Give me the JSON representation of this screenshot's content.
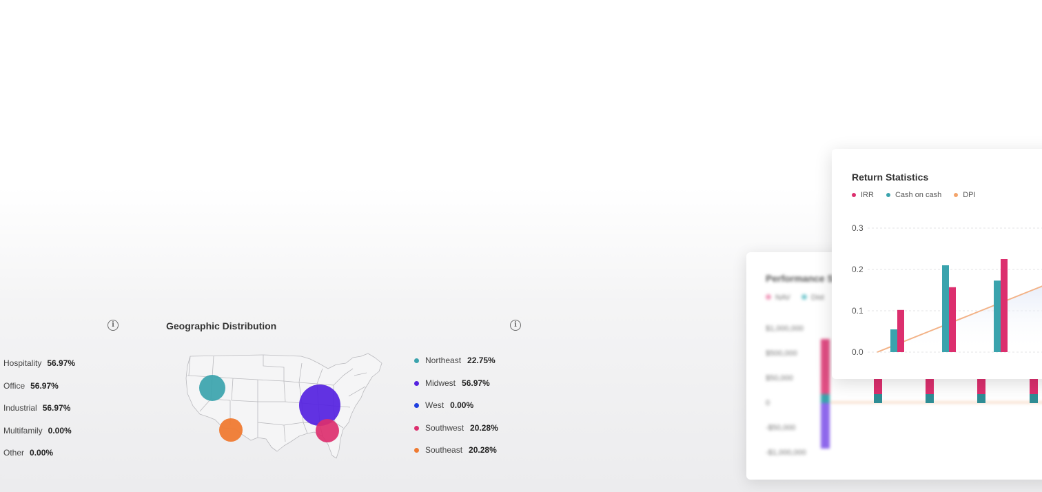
{
  "property_types": {
    "items": [
      {
        "label": "Hospitality",
        "value": "56.97%"
      },
      {
        "label": "Office",
        "value": "56.97%"
      },
      {
        "label": "Industrial",
        "value": "56.97%"
      },
      {
        "label": "Multifamily",
        "value": "0.00%"
      },
      {
        "label": "Other",
        "value": "0.00%"
      }
    ],
    "info_icon": "info-icon"
  },
  "geographic": {
    "title": "Geographic Distribution",
    "info_icon": "info-icon",
    "regions": [
      {
        "label": "Northeast",
        "value": "22.75%",
        "color": "#3aa3ad"
      },
      {
        "label": "Midwest",
        "value": "56.97%",
        "color": "#5522e0"
      },
      {
        "label": "West",
        "value": "0.00%",
        "color": "#1f3fe0"
      },
      {
        "label": "Southwest",
        "value": "20.28%",
        "color": "#dc2f6e"
      },
      {
        "label": "Southeast",
        "value": "20.28%",
        "color": "#ef7a31"
      }
    ]
  },
  "performance": {
    "title": "Performance S",
    "legend": [
      "NAV",
      "Dist"
    ],
    "axis": [
      "$1,000,000",
      "$500,000",
      "$50,000",
      "0",
      "-$50,000",
      "-$1,000,000"
    ]
  },
  "return_statistics": {
    "title": "Return Statistics",
    "legend": [
      {
        "label": "IRR",
        "color": "#dc2f6e"
      },
      {
        "label": "Cash on cash",
        "color": "#3aa3ad"
      },
      {
        "label": "DPI",
        "color": "#f3a46b"
      }
    ]
  },
  "chart_data": {
    "type": "bar",
    "title": "Return Statistics",
    "yticks": [
      "0.3",
      "0.2",
      "0.1",
      "0.0"
    ],
    "ylim": [
      0,
      0.3
    ],
    "grid": true,
    "legend_position": "top-left",
    "series": [
      {
        "name": "Cash on cash",
        "values": [
          0.055,
          0.21,
          0.173
        ]
      },
      {
        "name": "IRR",
        "values": [
          0.102,
          0.157,
          0.225
        ]
      },
      {
        "name": "DPI",
        "values": [
          0.0,
          0.05,
          0.1,
          0.15
        ]
      }
    ]
  }
}
